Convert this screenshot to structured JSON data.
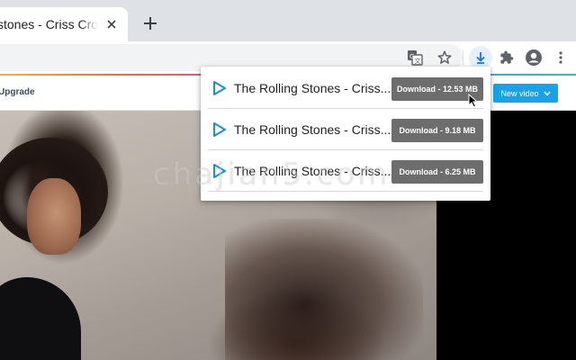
{
  "browser": {
    "tab": {
      "title": "stones - Criss Cros",
      "close_icon": "close-icon"
    },
    "new_tab_icon": "plus-icon",
    "toolbar_icons": [
      "translate-icon",
      "star-icon",
      "download-icon",
      "puzzle-icon",
      "profile-icon",
      "menu-icon"
    ]
  },
  "page": {
    "upgrade_label": "Upgrade",
    "new_video_label": "New video",
    "watermark": "chajian5.com"
  },
  "downloads": [
    {
      "title": "The Rolling Stones - Criss...",
      "button_label": "Download - 12.53 MB"
    },
    {
      "title": "The Rolling Stones - Criss...",
      "button_label": "Download - 9.18 MB"
    },
    {
      "title": "The Rolling Stones - Criss...",
      "button_label": "Download - 6.25 MB"
    }
  ],
  "colors": {
    "accent": "#16a4e6",
    "play_icon": "#1a8fd1",
    "download_button": "#6d6d6d",
    "download_toolbar_icon": "#1a73e8"
  }
}
